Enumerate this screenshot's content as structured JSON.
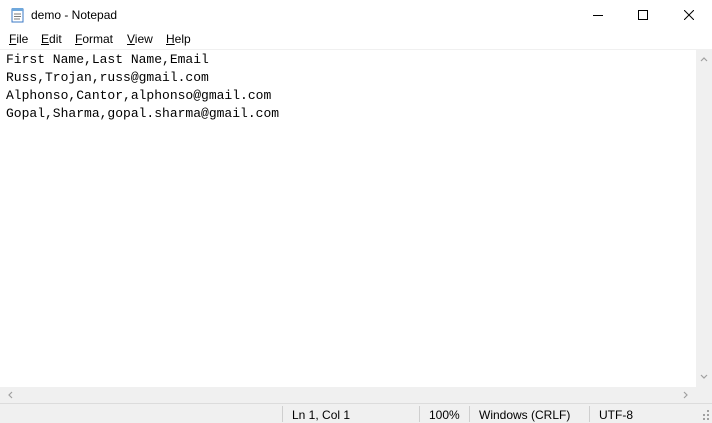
{
  "window": {
    "title": "demo - Notepad",
    "icons": {
      "app": "notepad-icon",
      "minimize": "minimize-icon",
      "maximize": "maximize-icon",
      "close": "close-icon"
    }
  },
  "menu": [
    {
      "accel": "F",
      "rest": "ile"
    },
    {
      "accel": "E",
      "rest": "dit"
    },
    {
      "accel": "F",
      "rest": "ormat",
      "pre": ""
    },
    {
      "accel": "V",
      "rest": "iew"
    },
    {
      "accel": "H",
      "rest": "elp"
    }
  ],
  "editor": {
    "lines": [
      "First Name,Last Name,Email",
      "Russ,Trojan,russ@gmail.com",
      "Alphonso,Cantor,alphonso@gmail.com",
      "Gopal,Sharma,gopal.sharma@gmail.com"
    ]
  },
  "status": {
    "position": "Ln 1, Col 1",
    "zoom": "100%",
    "line_ending": "Windows (CRLF)",
    "encoding": "UTF-8"
  },
  "colors": {
    "chrome": "#f0f0f0",
    "text": "#000000",
    "arrow": "#a0a0a0"
  }
}
